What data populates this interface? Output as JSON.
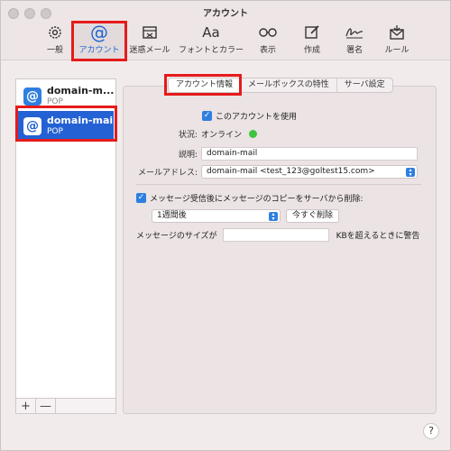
{
  "window": {
    "title": "アカウント"
  },
  "toolbar": {
    "items": [
      {
        "label": "一般",
        "icon": "gear-icon"
      },
      {
        "label": "アカウント",
        "icon": "at-icon"
      },
      {
        "label": "迷惑メール",
        "icon": "junk-icon"
      },
      {
        "label": "フォントとカラー",
        "icon": "font-icon",
        "glyph": "Aa"
      },
      {
        "label": "表示",
        "icon": "glasses-icon"
      },
      {
        "label": "作成",
        "icon": "compose-icon"
      },
      {
        "label": "署名",
        "icon": "signature-icon"
      },
      {
        "label": "ルール",
        "icon": "rules-icon"
      }
    ],
    "active_index": 1
  },
  "sidebar": {
    "accounts": [
      {
        "name": "domain-m...",
        "type": "POP",
        "selected": false
      },
      {
        "name": "domain-mail",
        "type": "POP",
        "selected": true
      }
    ],
    "add_label": "+",
    "remove_label": "—"
  },
  "tabs": [
    {
      "label": "アカウント情報",
      "active": true
    },
    {
      "label": "メールボックスの特性",
      "active": false
    },
    {
      "label": "サーバ設定",
      "active": false
    }
  ],
  "form": {
    "use_account_label": "このアカウントを使用",
    "status_label": "状況:",
    "status_value": "オンライン",
    "description_label": "説明:",
    "description_value": "domain-mail",
    "email_label": "メールアドレス:",
    "email_value": "domain-mail <test_123@goltest15.com>",
    "remove_copy_label": "メッセージ受信後にメッセージのコピーをサーバから削除:",
    "remove_period": "1週間後",
    "remove_now_label": "今すぐ削除",
    "size_label": "メッセージのサイズが",
    "size_value": "",
    "size_suffix": "KBを超えるときに警告"
  },
  "help_label": "?",
  "colors": {
    "accent": "#2461d4",
    "highlight": "#e51b1b",
    "online": "#3ec43e"
  }
}
